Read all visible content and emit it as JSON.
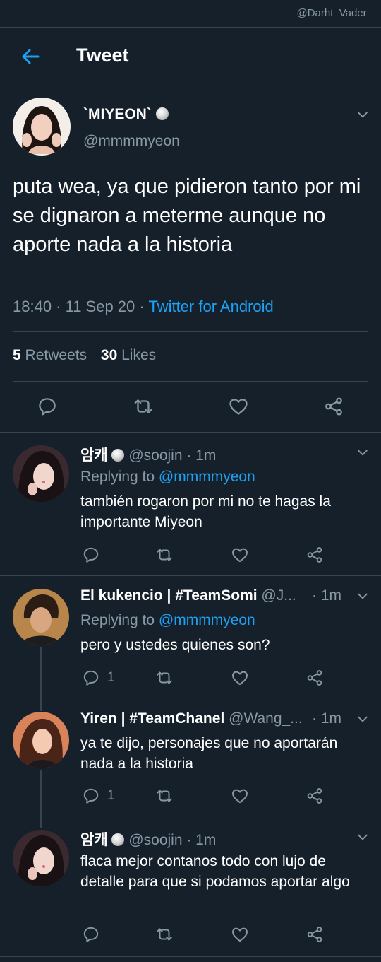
{
  "watermark": "@Darht_Vader_",
  "header": {
    "title": "Tweet"
  },
  "main_tweet": {
    "display_name": "`MIYEON`",
    "handle": "@mmmmyeon",
    "text": "puta wea, ya que pidieron tanto por mi se dignaron a meterme aunque no aporte nada a la historia",
    "time": "18:40 · 11 Sep 20 ·",
    "source": "Twitter for Android",
    "retweets_count": "5",
    "retweets_label": "Retweets",
    "likes_count": "30",
    "likes_label": "Likes"
  },
  "icons": {
    "back": "arrow-left-icon",
    "reply": "reply-icon",
    "retweet": "retweet-icon",
    "like": "heart-icon",
    "share": "share-icon",
    "menu": "chevron-down-icon",
    "badge": "pearl-badge-icon"
  },
  "colors": {
    "background": "#15202b",
    "accent": "#1da1f2",
    "muted": "#8899a6",
    "divider": "#38444d"
  },
  "replies": [
    {
      "display_name": "암캐",
      "handle": "@soojin",
      "time": "· 1m",
      "replying_label": "Replying to",
      "replying_to": "@mmmmyeon",
      "text": "también rogaron por mi no te hagas la importante Miyeon",
      "reply_count": ""
    },
    {
      "display_name": "El kukencio | #TeamSomi",
      "handle": "@J...",
      "time": "· 1m",
      "replying_label": "Replying to",
      "replying_to": "@mmmmyeon",
      "text": "pero y ustedes quienes son?",
      "reply_count": "1"
    },
    {
      "display_name": "Yiren | #TeamChanel",
      "handle": "@Wang_...",
      "time": "· 1m",
      "text": "ya te dijo, personajes que no aportarán nada a la historia",
      "reply_count": "1"
    },
    {
      "display_name": "암캐",
      "handle": "@soojin",
      "time": "· 1m",
      "text": "flaca mejor contanos todo con lujo de detalle para que si podamos aportar algo",
      "reply_count": ""
    }
  ]
}
